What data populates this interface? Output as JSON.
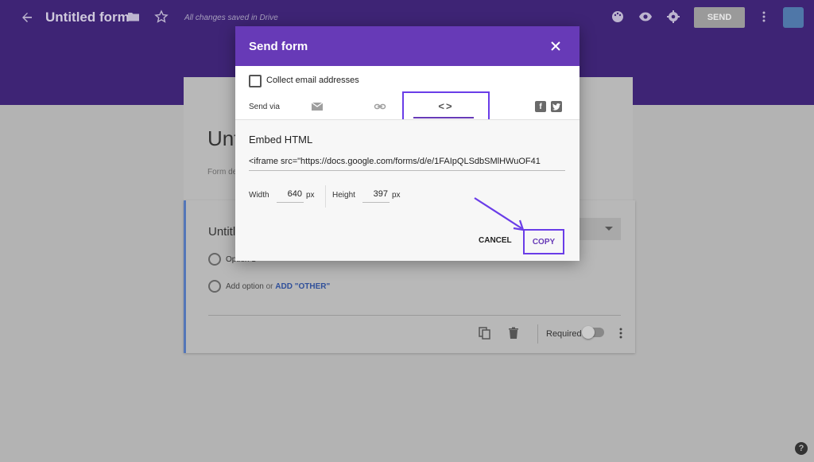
{
  "topbar": {
    "title": "Untitled form",
    "saved_status": "All changes saved in Drive",
    "send_label": "SEND"
  },
  "form": {
    "title": "Untitled form",
    "description": "Form description"
  },
  "question": {
    "title": "Untitled Question",
    "option1": "Option 1",
    "add_option": "Add option",
    "or": "or",
    "add_other": "ADD \"OTHER\"",
    "required_label": "Required"
  },
  "dialog": {
    "title": "Send form",
    "collect_label": "Collect email addresses",
    "send_via_label": "Send via",
    "embed_glyph": "<>",
    "embed_heading": "Embed HTML",
    "embed_code": "<iframe src=\"https://docs.google.com/forms/d/e/1FAIpQLSdbSMlHWuOF41",
    "width_label": "Width",
    "width_value": "640",
    "height_label": "Height",
    "height_value": "397",
    "unit": "px",
    "cancel_label": "CANCEL",
    "copy_label": "COPY"
  },
  "help": "?",
  "colors": {
    "accent": "#673ab7",
    "highlight_box": "#6a3de8"
  }
}
